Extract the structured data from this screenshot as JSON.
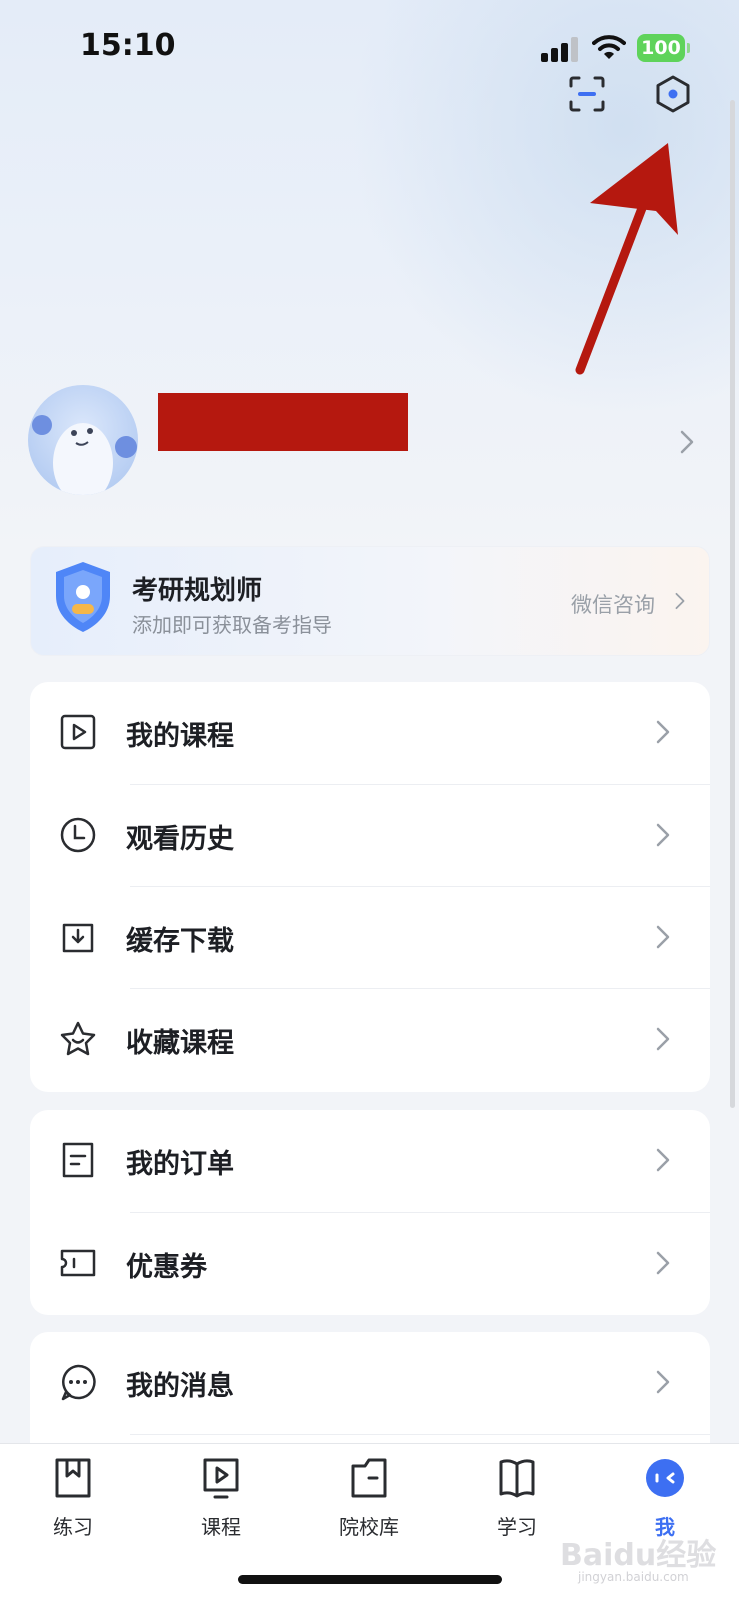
{
  "status_bar": {
    "time": "15:10",
    "battery": "100"
  },
  "profile": {
    "name": ""
  },
  "planner": {
    "title": "考研规划师",
    "subtitle": "添加即可获取备考指导",
    "cta": "微信咨询"
  },
  "menu_group_1": [
    {
      "label": "我的课程",
      "icon": "play-square-icon"
    },
    {
      "label": "观看历史",
      "icon": "clock-icon"
    },
    {
      "label": "缓存下载",
      "icon": "download-icon"
    },
    {
      "label": "收藏课程",
      "icon": "star-icon"
    }
  ],
  "menu_group_2": [
    {
      "label": "我的订单",
      "icon": "order-icon"
    },
    {
      "label": "优惠券",
      "icon": "coupon-icon"
    }
  ],
  "menu_group_3": [
    {
      "label": "我的消息",
      "icon": "message-icon"
    }
  ],
  "tabbar": [
    {
      "label": "练习",
      "icon": "bookmark-book-icon"
    },
    {
      "label": "课程",
      "icon": "play-screen-icon"
    },
    {
      "label": "院校库",
      "icon": "folder-icon"
    },
    {
      "label": "学习",
      "icon": "open-book-icon"
    },
    {
      "label": "我",
      "icon": "profile-face-icon",
      "active": true
    }
  ],
  "watermark": {
    "text": "Baidu经验",
    "sub": "jingyan.baidu.com"
  },
  "colors": {
    "accent": "#3d6ff2",
    "annotation": "#b5180f",
    "battery": "#5fd35b"
  }
}
